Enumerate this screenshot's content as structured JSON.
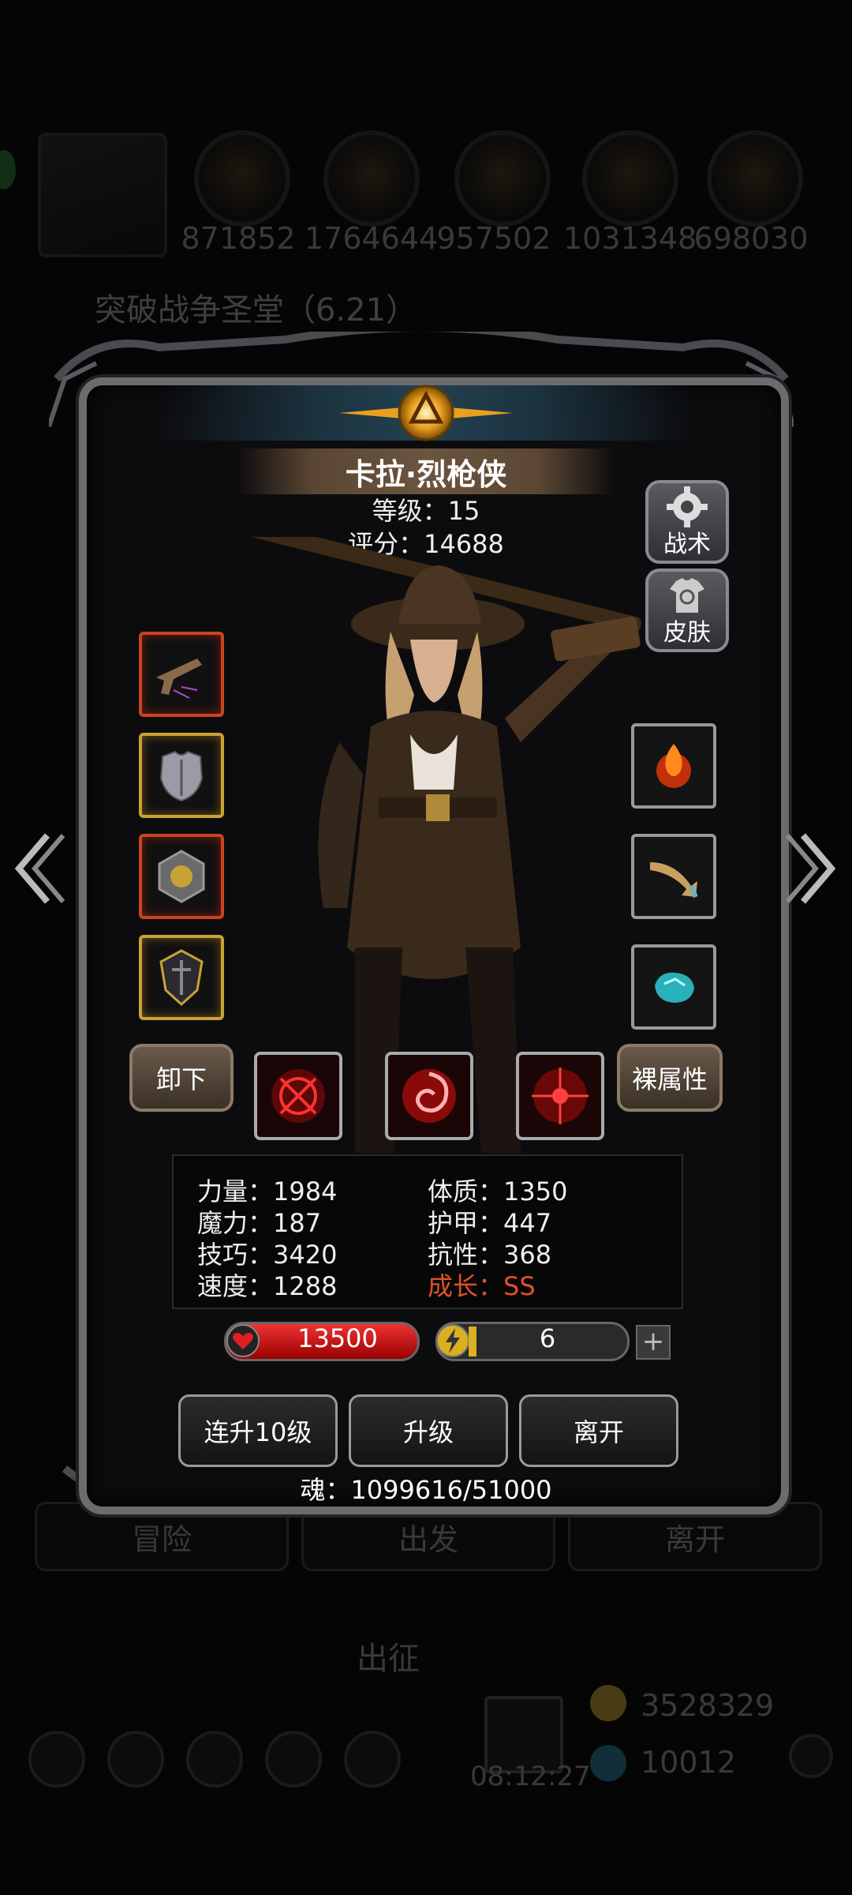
{
  "background": {
    "hero_scores": [
      "871852",
      "1764644",
      "957502",
      "1031348",
      "698030"
    ],
    "event_title": "突破战争圣堂（6.21）",
    "tabs": [
      "冒险",
      "出发",
      "离开"
    ],
    "expedition": "出征",
    "gold": "3528329",
    "gems": "10012",
    "timer": "08:12:27"
  },
  "hero": {
    "name": "卡拉·烈枪侠",
    "level": "等级：15",
    "score": "评分：14688"
  },
  "side_buttons": {
    "tactics": "战术",
    "skin": "皮肤"
  },
  "equipment_left": [
    "pistol-icon",
    "armor-icon",
    "ring-icon",
    "shield-icon"
  ],
  "equipment_right": [
    "fire-orb-icon",
    "horn-icon",
    "gem-icon"
  ],
  "actions": {
    "unequip": "卸下",
    "base_attr": "裸属性"
  },
  "stats": {
    "strength": "力量：1984",
    "constitution": "体质：1350",
    "magic": "魔力：187",
    "armor": "护甲：447",
    "skill": "技巧：3420",
    "resist": "抗性：368",
    "speed": "速度：1288",
    "growth": "成长：SS"
  },
  "bars": {
    "hp": "13500",
    "energy": "6",
    "plus": "+"
  },
  "buttons": {
    "level10": "连升10级",
    "levelup": "升级",
    "leave": "离开"
  },
  "souls": "魂：1099616/51000",
  "colors": {
    "growth": "#e0502a",
    "hp_bar": "#d42a2a",
    "slot_red": "#c8451f",
    "slot_gold": "#c9a235"
  }
}
